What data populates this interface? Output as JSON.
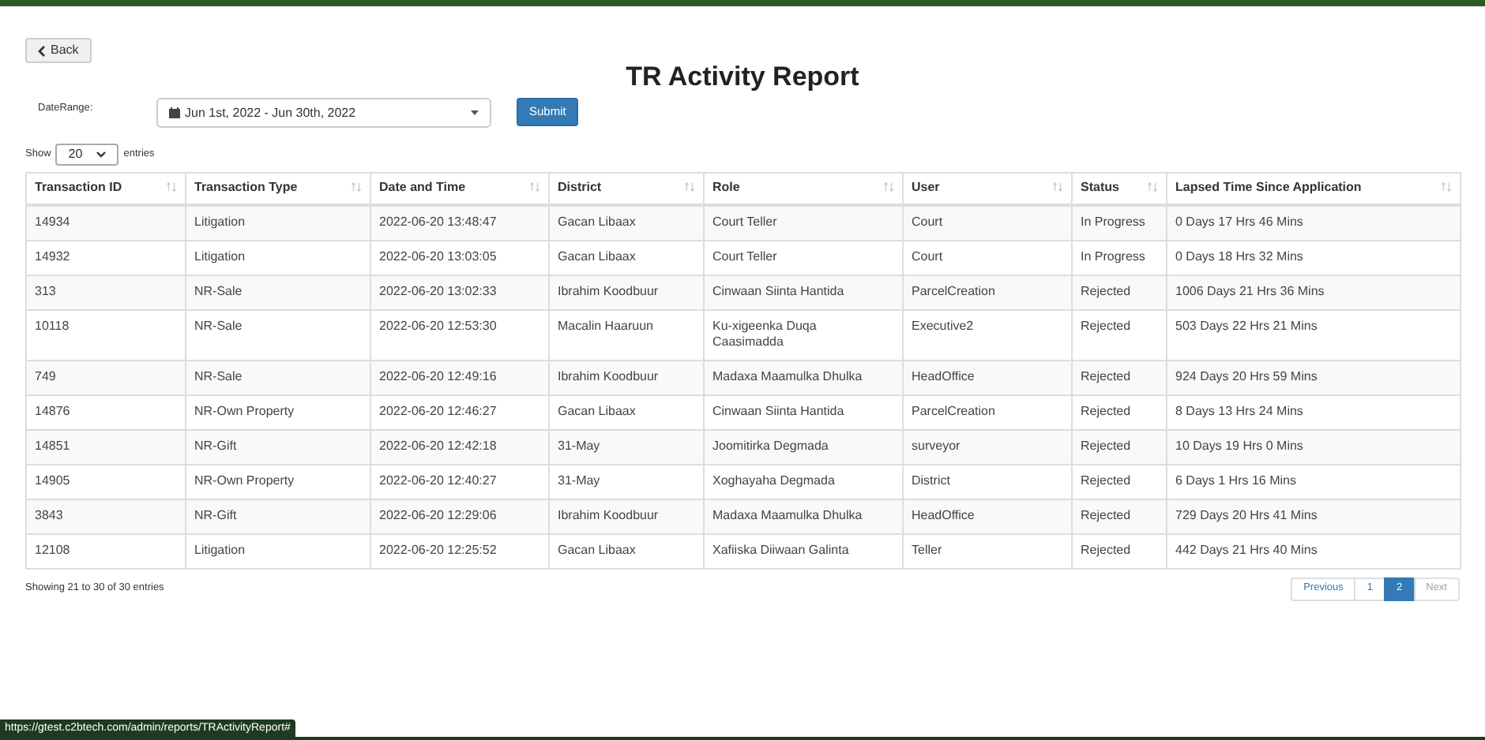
{
  "back_button": {
    "label": "Back"
  },
  "title": "TR Activity Report",
  "date_range": {
    "label": "DateRange:",
    "value": "Jun 1st, 2022 - Jun 30th, 2022"
  },
  "submit_button": {
    "label": "Submit"
  },
  "page_length": {
    "prefix": "Show",
    "value": "20",
    "suffix": "entries"
  },
  "table": {
    "columns": [
      "Transaction ID",
      "Transaction Type",
      "Date and Time",
      "District",
      "Role",
      "User",
      "Status",
      "Lapsed Time Since Application"
    ],
    "rows": [
      [
        "14934",
        "Litigation",
        "2022-06-20 13:48:47",
        "Gacan Libaax",
        "Court Teller",
        "Court",
        "In Progress",
        "0 Days 17 Hrs 46 Mins"
      ],
      [
        "14932",
        "Litigation",
        "2022-06-20 13:03:05",
        "Gacan Libaax",
        "Court Teller",
        "Court",
        "In Progress",
        "0 Days 18 Hrs 32 Mins"
      ],
      [
        "313",
        "NR-Sale",
        "2022-06-20 13:02:33",
        "Ibrahim Koodbuur",
        "Cinwaan Siinta Hantida",
        "ParcelCreation",
        "Rejected",
        "1006 Days 21 Hrs 36 Mins"
      ],
      [
        "10118",
        "NR-Sale",
        "2022-06-20 12:53:30",
        "Macalin Haaruun",
        "Ku-xigeenka Duqa Caasimadda",
        "Executive2",
        "Rejected",
        "503 Days 22 Hrs 21 Mins"
      ],
      [
        "749",
        "NR-Sale",
        "2022-06-20 12:49:16",
        "Ibrahim Koodbuur",
        "Madaxa Maamulka Dhulka",
        "HeadOffice",
        "Rejected",
        "924 Days 20 Hrs 59 Mins"
      ],
      [
        "14876",
        "NR-Own Property",
        "2022-06-20 12:46:27",
        "Gacan Libaax",
        "Cinwaan Siinta Hantida",
        "ParcelCreation",
        "Rejected",
        "8 Days 13 Hrs 24 Mins"
      ],
      [
        "14851",
        "NR-Gift",
        "2022-06-20 12:42:18",
        "31-May",
        "Joomitirka Degmada",
        "surveyor",
        "Rejected",
        "10 Days 19 Hrs 0 Mins"
      ],
      [
        "14905",
        "NR-Own Property",
        "2022-06-20 12:40:27",
        "31-May",
        "Xoghayaha Degmada",
        "District",
        "Rejected",
        "6 Days 1 Hrs 16 Mins"
      ],
      [
        "3843",
        "NR-Gift",
        "2022-06-20 12:29:06",
        "Ibrahim Koodbuur",
        "Madaxa Maamulka Dhulka",
        "HeadOffice",
        "Rejected",
        "729 Days 20 Hrs 41 Mins"
      ],
      [
        "12108",
        "Litigation",
        "2022-06-20 12:25:52",
        "Gacan Libaax",
        "Xafiiska Diiwaan Galinta",
        "Teller",
        "Rejected",
        "442 Days 21 Hrs 40 Mins"
      ]
    ]
  },
  "info": "Showing 21 to 30 of 30 entries",
  "pagination": [
    {
      "label": "Previous",
      "selected": false,
      "disabled": false
    },
    {
      "label": "1",
      "selected": false,
      "disabled": false
    },
    {
      "label": "2",
      "selected": true,
      "disabled": false
    },
    {
      "label": "Next",
      "selected": false,
      "disabled": true
    }
  ],
  "status_bar": "https://gtest.c2btech.com/admin/reports/TRActivityReport#"
}
